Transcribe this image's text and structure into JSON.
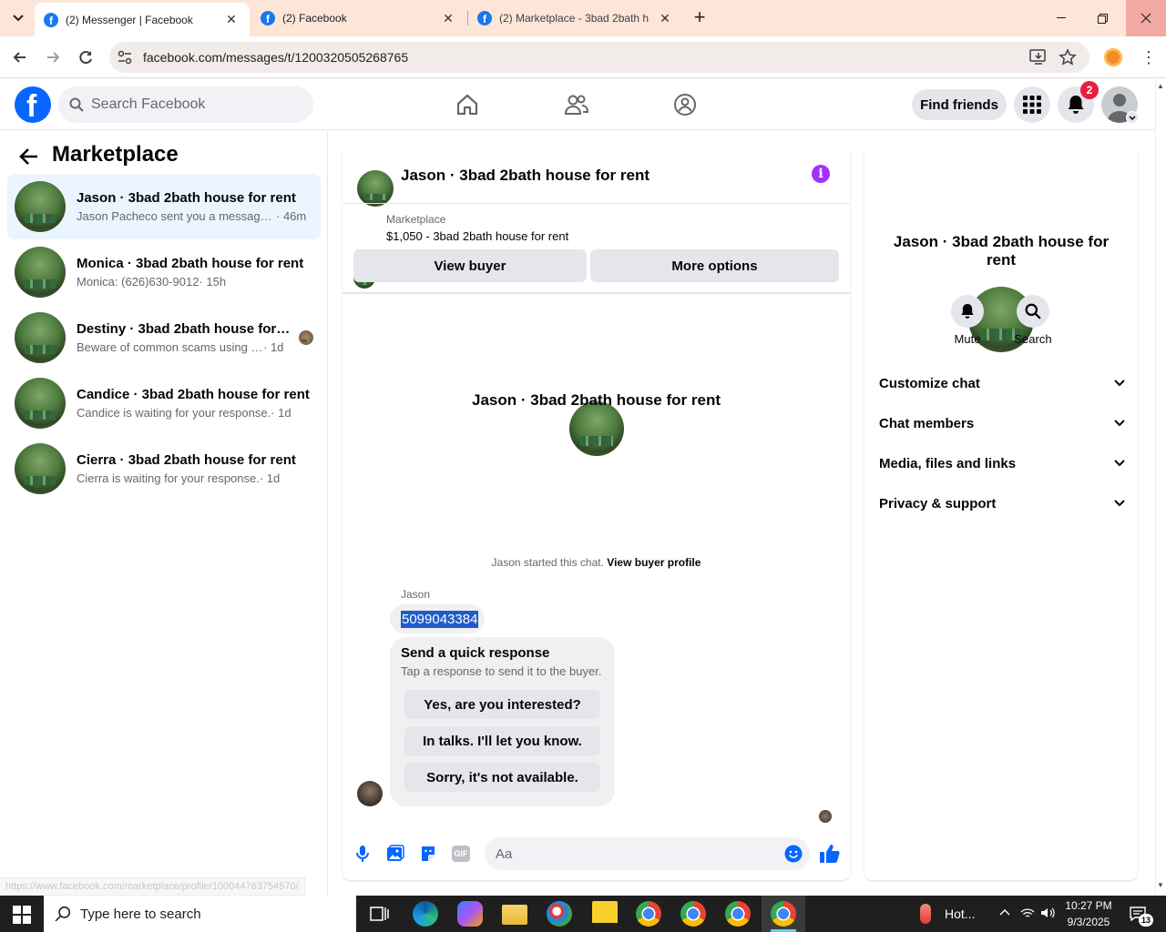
{
  "browser": {
    "tabs": [
      {
        "title": "(2) Messenger | Facebook"
      },
      {
        "title": "(2) Facebook"
      },
      {
        "title": "(2) Marketplace - 3bad 2bath h"
      }
    ],
    "new_tab_glyph": "+",
    "close_glyph": "✕",
    "url": "facebook.com/messages/t/1200320505268765",
    "status_url": "https://www.facebook.com/marketplace/profile/100044763754570/"
  },
  "fb": {
    "logo_letter": "f",
    "search_placeholder": "Search Facebook",
    "find_friends": "Find friends",
    "notification_count": "2"
  },
  "left": {
    "title": "Marketplace",
    "conversations": [
      {
        "name": "Jason · 3bad 2bath house for rent",
        "preview": "Jason Pacheco sent you a message ...",
        "time": "· 46m",
        "selected": true
      },
      {
        "name": "Monica · 3bad 2bath house for rent",
        "preview": "Monica: (626)630-9012",
        "time": " · 15h",
        "selected": false
      },
      {
        "name": "Destiny · 3bad 2bath house for r...",
        "preview": "Beware of common scams using p...",
        "time": " · 1d",
        "selected": false
      },
      {
        "name": "Candice · 3bad 2bath house for rent",
        "preview": "Candice is waiting for your response.",
        "time": " · 1d",
        "selected": false
      },
      {
        "name": "Cierra · 3bad 2bath house for rent",
        "preview": "Cierra is waiting for your response.",
        "time": " · 1d",
        "selected": false
      }
    ]
  },
  "chat": {
    "title": "Jason · 3bad 2bath house for rent",
    "listing_label": "Marketplace",
    "listing_desc": "$1,050 - 3bad 2bath house for rent",
    "view_buyer": "View buyer",
    "more_options": "More options",
    "intro_name": "Jason · 3bad 2bath house for rent",
    "started_text": "Jason started this chat.",
    "view_buyer_profile": "View buyer profile",
    "sender": "Jason",
    "message": "5099043384",
    "quick_title": "Send a quick response",
    "quick_sub": "Tap a response to send it to the buyer.",
    "quick_options": [
      "Yes, are you interested?",
      "In talks. I'll let you know.",
      "Sorry, it's not available."
    ],
    "composer_placeholder": "Aa"
  },
  "right": {
    "name": "Jason · 3bad 2bath house for rent",
    "mute": "Mute",
    "search": "Search",
    "sections": [
      "Customize chat",
      "Chat members",
      "Media, files and links",
      "Privacy & support"
    ]
  },
  "taskbar": {
    "search_placeholder": "Type here to search",
    "weather": "Hot...",
    "time": "10:27 PM",
    "date": "9/3/2025",
    "notif_count": "13"
  },
  "colors": {
    "fb_blue": "#0866ff",
    "messenger_purple": "#a033ff",
    "selected_bg": "#ebf5ff",
    "highlight": "#1f5cc9"
  }
}
